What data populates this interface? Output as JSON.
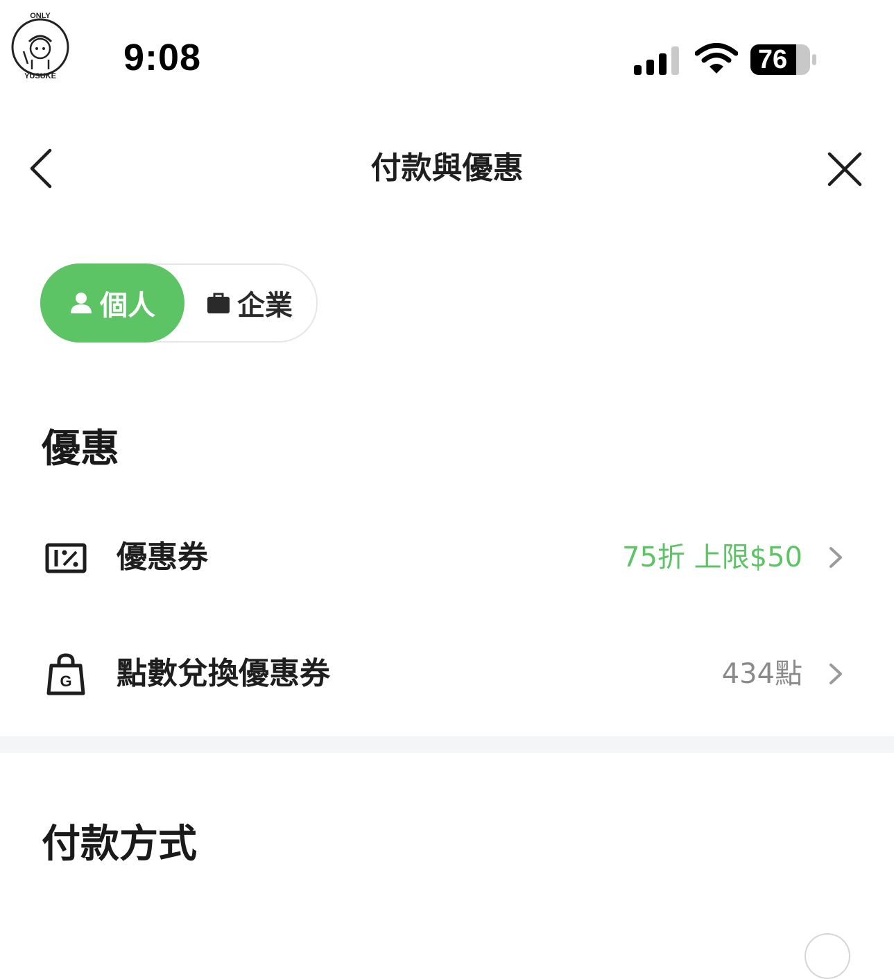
{
  "status_bar": {
    "time": "9:08",
    "battery_level": "76",
    "icons": [
      "cellular-signal-icon",
      "wifi-icon",
      "battery-icon"
    ]
  },
  "logo": {
    "top_text": "ONLY",
    "bottom_text": "YUSUKE"
  },
  "nav": {
    "title": "付款與優惠",
    "back_icon": "chevron-left-icon",
    "close_icon": "close-icon"
  },
  "profile_toggle": {
    "selected": "個人",
    "options": [
      {
        "label": "個人",
        "icon": "person-icon"
      },
      {
        "label": "企業",
        "icon": "briefcase-icon"
      }
    ]
  },
  "offers": {
    "title": "優惠",
    "items": [
      {
        "label": "優惠券",
        "value": "75折 上限$50",
        "icon": "coupon-icon"
      },
      {
        "label": "點數兌換優惠券",
        "value": "434點",
        "icon": "shopping-bag-icon"
      }
    ]
  },
  "payment": {
    "title": "付款方式"
  },
  "colors": {
    "accent": "#5cc465",
    "value_grey": "#8a8a8a",
    "divider": "#f4f5f7"
  }
}
